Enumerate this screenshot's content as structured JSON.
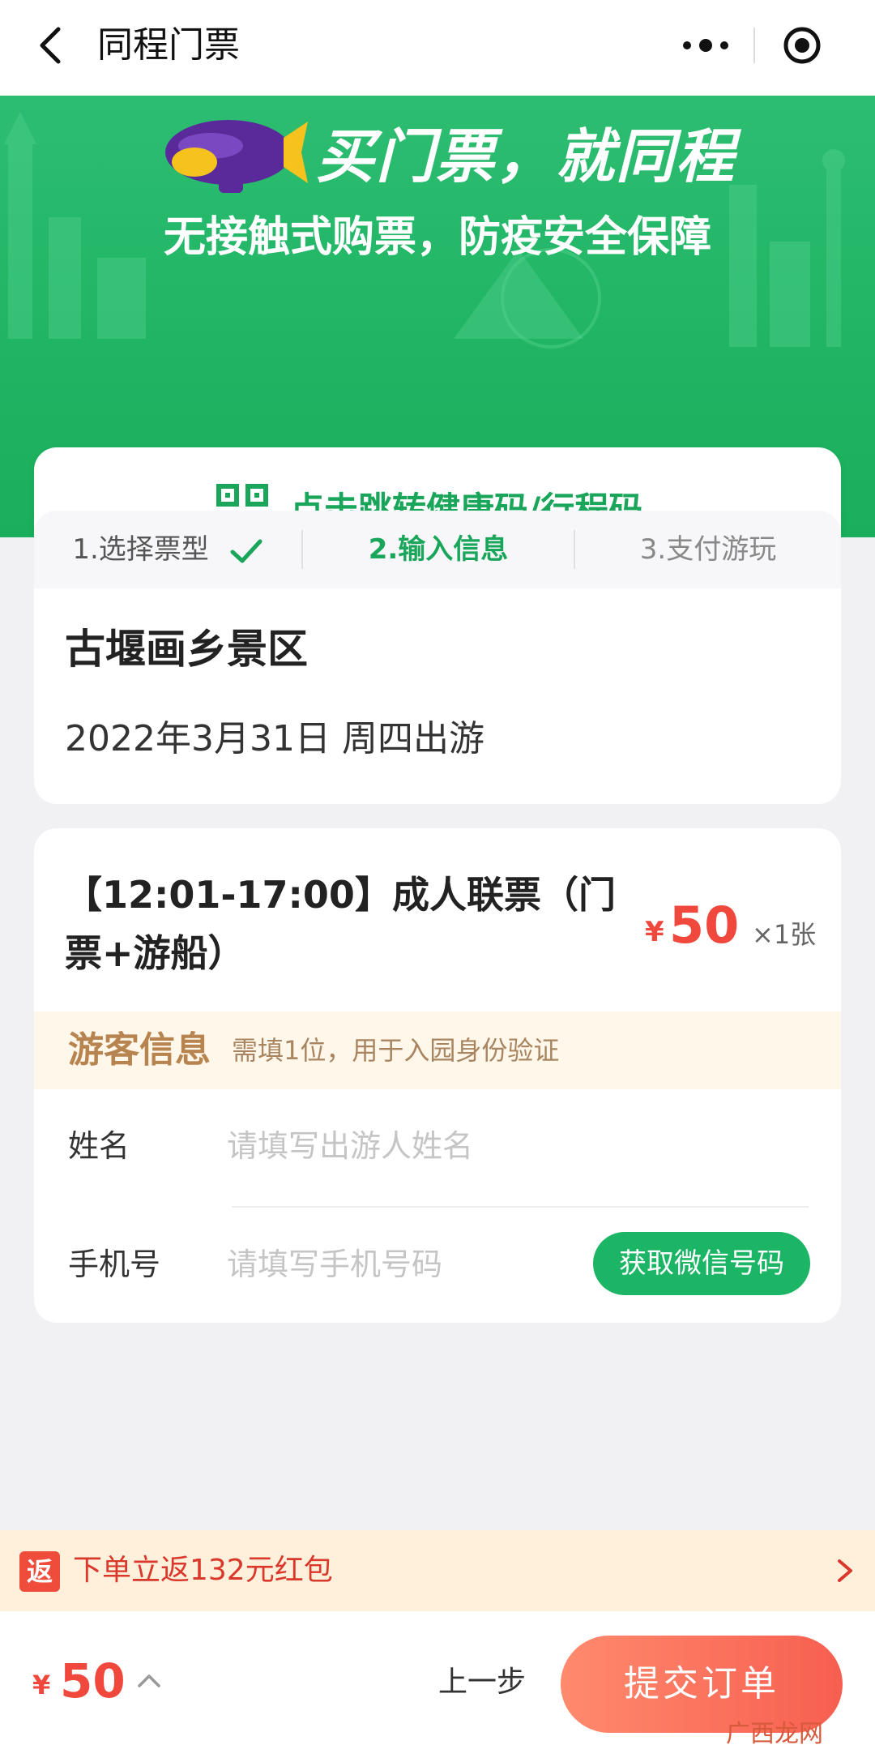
{
  "nav": {
    "title": "同程门票",
    "more_icon": "more-dots-icon",
    "target_icon": "circle-target-icon"
  },
  "banner": {
    "slogan": "买门票，就同程",
    "subslogan": "无接触式购票，防疫安全保障",
    "health_link": "点击跳转健康码/行程码",
    "colors": {
      "green": "#1fb463",
      "accent_text": "#1aa65a"
    }
  },
  "steps": [
    {
      "label": "1.选择票型",
      "state": "done"
    },
    {
      "label": "2.输入信息",
      "state": "active"
    },
    {
      "label": "3.支付游玩",
      "state": "pending"
    }
  ],
  "scenic": {
    "name": "古堰画乡景区",
    "date": "2022年3月31日 周四出游"
  },
  "ticket": {
    "name": "【12:01-17:00】成人联票（门票+游船）",
    "currency": "¥",
    "price": "50",
    "quantity": "×1张"
  },
  "guest": {
    "title": "游客信息",
    "note": "需填1位，用于入园身份验证",
    "name_label": "姓名",
    "name_placeholder": "请填写出游人姓名",
    "phone_label": "手机号",
    "phone_placeholder": "请填写手机号码",
    "wechat_button": "获取微信号码"
  },
  "promo": {
    "badge": "返",
    "text": "下单立返132元红包"
  },
  "footer": {
    "currency": "¥",
    "total": "50",
    "prev_button": "上一步",
    "submit_button": "提交订单",
    "colors": {
      "price": "#f0483c",
      "submit": "#f75f50"
    }
  },
  "watermark": "广西龙网"
}
